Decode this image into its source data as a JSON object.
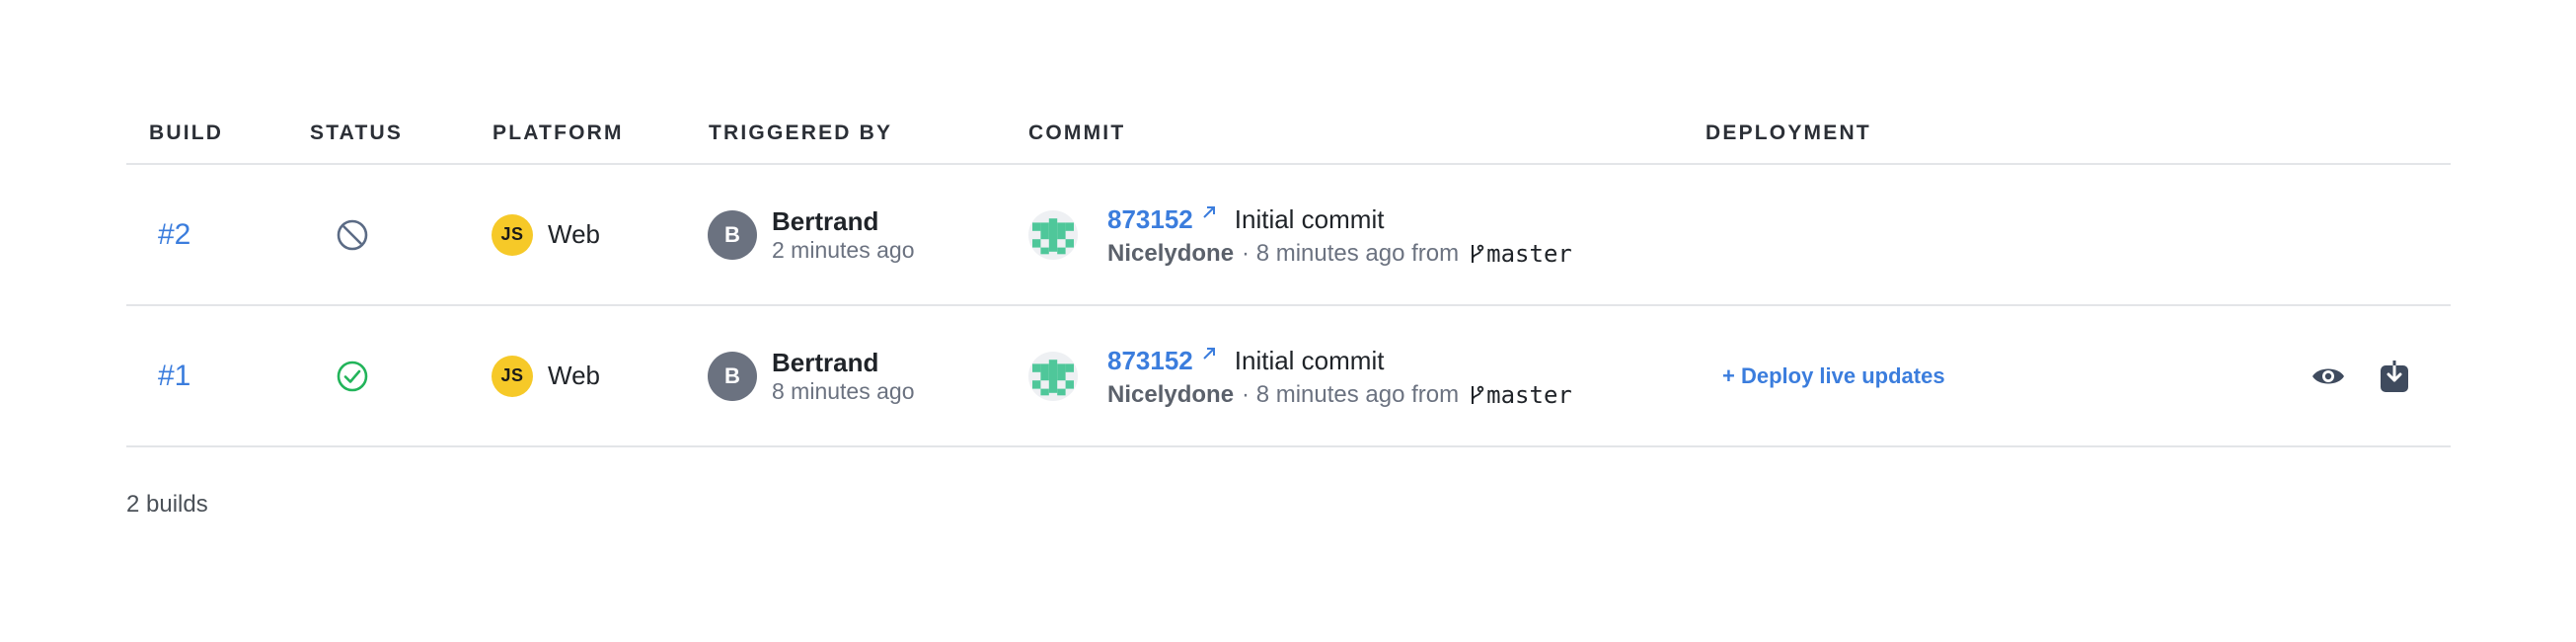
{
  "table": {
    "headers": {
      "build": "BUILD",
      "status": "STATUS",
      "platform": "PLATFORM",
      "triggered_by": "TRIGGERED BY",
      "commit": "COMMIT",
      "deployment": "DEPLOYMENT"
    },
    "rows": [
      {
        "build": "#2",
        "status": "canceled",
        "status_icon": "canceled-icon",
        "platform_badge": "JS",
        "platform": "Web",
        "user_initial": "B",
        "user_name": "Bertrand",
        "triggered_time": "2 minutes ago",
        "commit_hash": "873152",
        "commit_message": "Initial commit",
        "commit_author": "Nicelydone",
        "commit_meta": "· 8 minutes ago from",
        "branch": "master",
        "deploy_label": ""
      },
      {
        "build": "#1",
        "status": "success",
        "status_icon": "success-check-icon",
        "platform_badge": "JS",
        "platform": "Web",
        "user_initial": "B",
        "user_name": "Bertrand",
        "triggered_time": "8 minutes ago",
        "commit_hash": "873152",
        "commit_message": "Initial commit",
        "commit_author": "Nicelydone",
        "commit_meta": "· 8 minutes ago from",
        "branch": "master",
        "deploy_label": "+ Deploy live updates"
      }
    ]
  },
  "footer": {
    "count_label": "2 builds"
  },
  "colors": {
    "link": "#3b7ddd",
    "success": "#22b45a",
    "canceled": "#5b6b85",
    "js_badge": "#f6c928",
    "avatar": "#6b7280",
    "identicon": "#4fc79a",
    "action_icon": "#3f4b5e"
  }
}
